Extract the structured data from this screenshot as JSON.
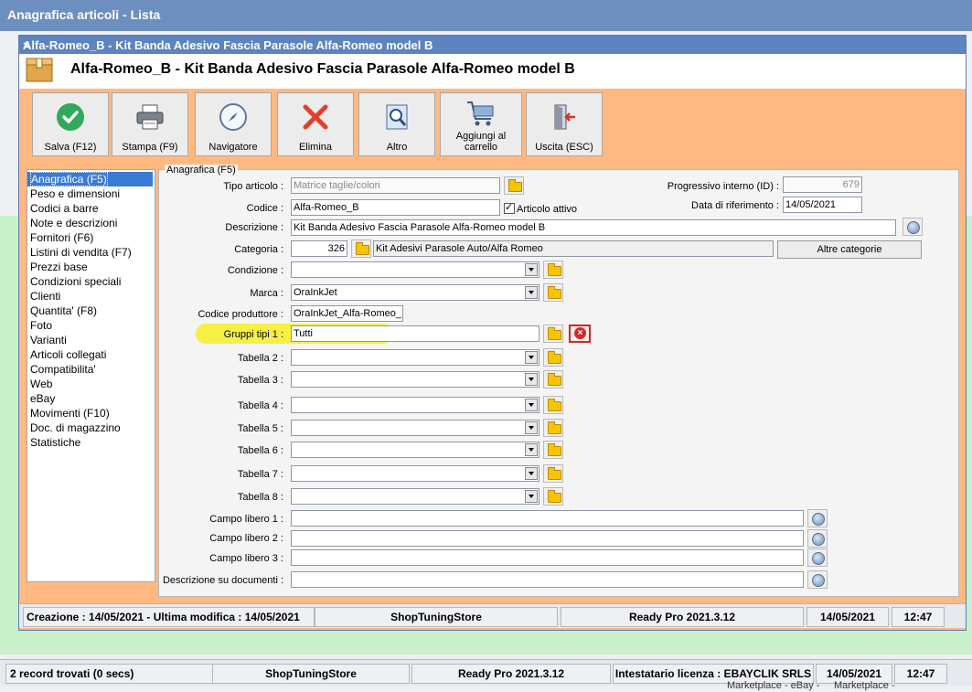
{
  "bg_window": {
    "title": "Anagrafica articoli  - Lista",
    "status": [
      "2 record trovati (0 secs)",
      "ShopTuningStore",
      "Ready Pro 2021.3.12",
      "Intestatario licenza : EBAYCLIK SRLS",
      "14/05/2021",
      "12:47"
    ],
    "under_text_1": "Marketplace - eBay -",
    "under_text_2": "Marketplace -"
  },
  "dialog": {
    "title": "Alfa-Romeo_B - Kit Banda Adesivo Fascia Parasole Alfa-Romeo model B",
    "header_title": "Alfa-Romeo_B - Kit Banda Adesivo Fascia Parasole Alfa-Romeo model B",
    "close": "×"
  },
  "toolbar": [
    {
      "label": "Salva (F12)",
      "icon": "check-icon"
    },
    {
      "label": "Stampa (F9)",
      "icon": "printer-icon"
    },
    {
      "label": "Navigatore",
      "icon": "compass-icon"
    },
    {
      "label": "Elimina",
      "icon": "delete-x-icon"
    },
    {
      "label": "Altro",
      "icon": "search-document-icon"
    },
    {
      "label": "Aggiungi al carrello",
      "icon": "cart-icon"
    },
    {
      "label": "Uscita (ESC)",
      "icon": "exit-door-icon"
    }
  ],
  "nav": [
    "Anagrafica (F5)",
    "Peso e dimensioni",
    "Codici a barre",
    "Note e descrizioni",
    "Fornitori (F6)",
    "Listini di vendita (F7)",
    "Prezzi base",
    "Condizioni speciali",
    "Clienti",
    "Quantita' (F8)",
    "Foto",
    "Varianti",
    "Articoli collegati",
    "Compatibilita'",
    "Web",
    "eBay",
    "Movimenti (F10)",
    "Doc. di magazzino",
    "Statistiche"
  ],
  "form": {
    "legend": "Anagrafica (F5)",
    "tipo_label": "Tipo articolo :",
    "tipo_value": "Matrice taglie/colori",
    "codice_label": "Codice :",
    "codice_value": "Alfa-Romeo_B",
    "attivo_label": "Articolo attivo",
    "progressivo_label": "Progressivo interno (ID) :",
    "progressivo_value": "679",
    "data_label": "Data di riferimento :",
    "data_value": "14/05/2021",
    "descrizione_label": "Descrizione :",
    "descrizione_value": "Kit Banda Adesivo Fascia Parasole Alfa-Romeo model B",
    "categoria_label": "Categoria :",
    "categoria_num": "326",
    "categoria_text": "Kit Adesivi Parasole Auto/Alfa Romeo",
    "altre_categorie": "Altre categorie",
    "condizione_label": "Condizione :",
    "condizione_value": "",
    "marca_label": "Marca :",
    "marca_value": "OraInkJet",
    "codprod_label": "Codice produttore :",
    "codprod_value": "OraInkJet_Alfa-Romeo_I",
    "gruppi_label": "Gruppi tipi 1 :",
    "gruppi_value": "Tutti",
    "tabelle": [
      "Tabella 2 :",
      "Tabella 3 :",
      "Tabella 4 :",
      "Tabella 5 :",
      "Tabella 6 :",
      "Tabella 7 :",
      "Tabella 8 :"
    ],
    "campi": [
      "Campo libero 1 :",
      "Campo libero 2 :",
      "Campo libero 3 :",
      "Descrizione su documenti :"
    ]
  },
  "status": [
    "Creazione : 14/05/2021 - Ultima modifica : 14/05/2021",
    "ShopTuningStore",
    "Ready Pro 2021.3.12",
    "14/05/2021",
    "12:47"
  ],
  "colors": {
    "accent": "#ffb880",
    "selection": "#3a7bd5",
    "title": "#5d83c1",
    "highlight": "#f5ef3a"
  }
}
